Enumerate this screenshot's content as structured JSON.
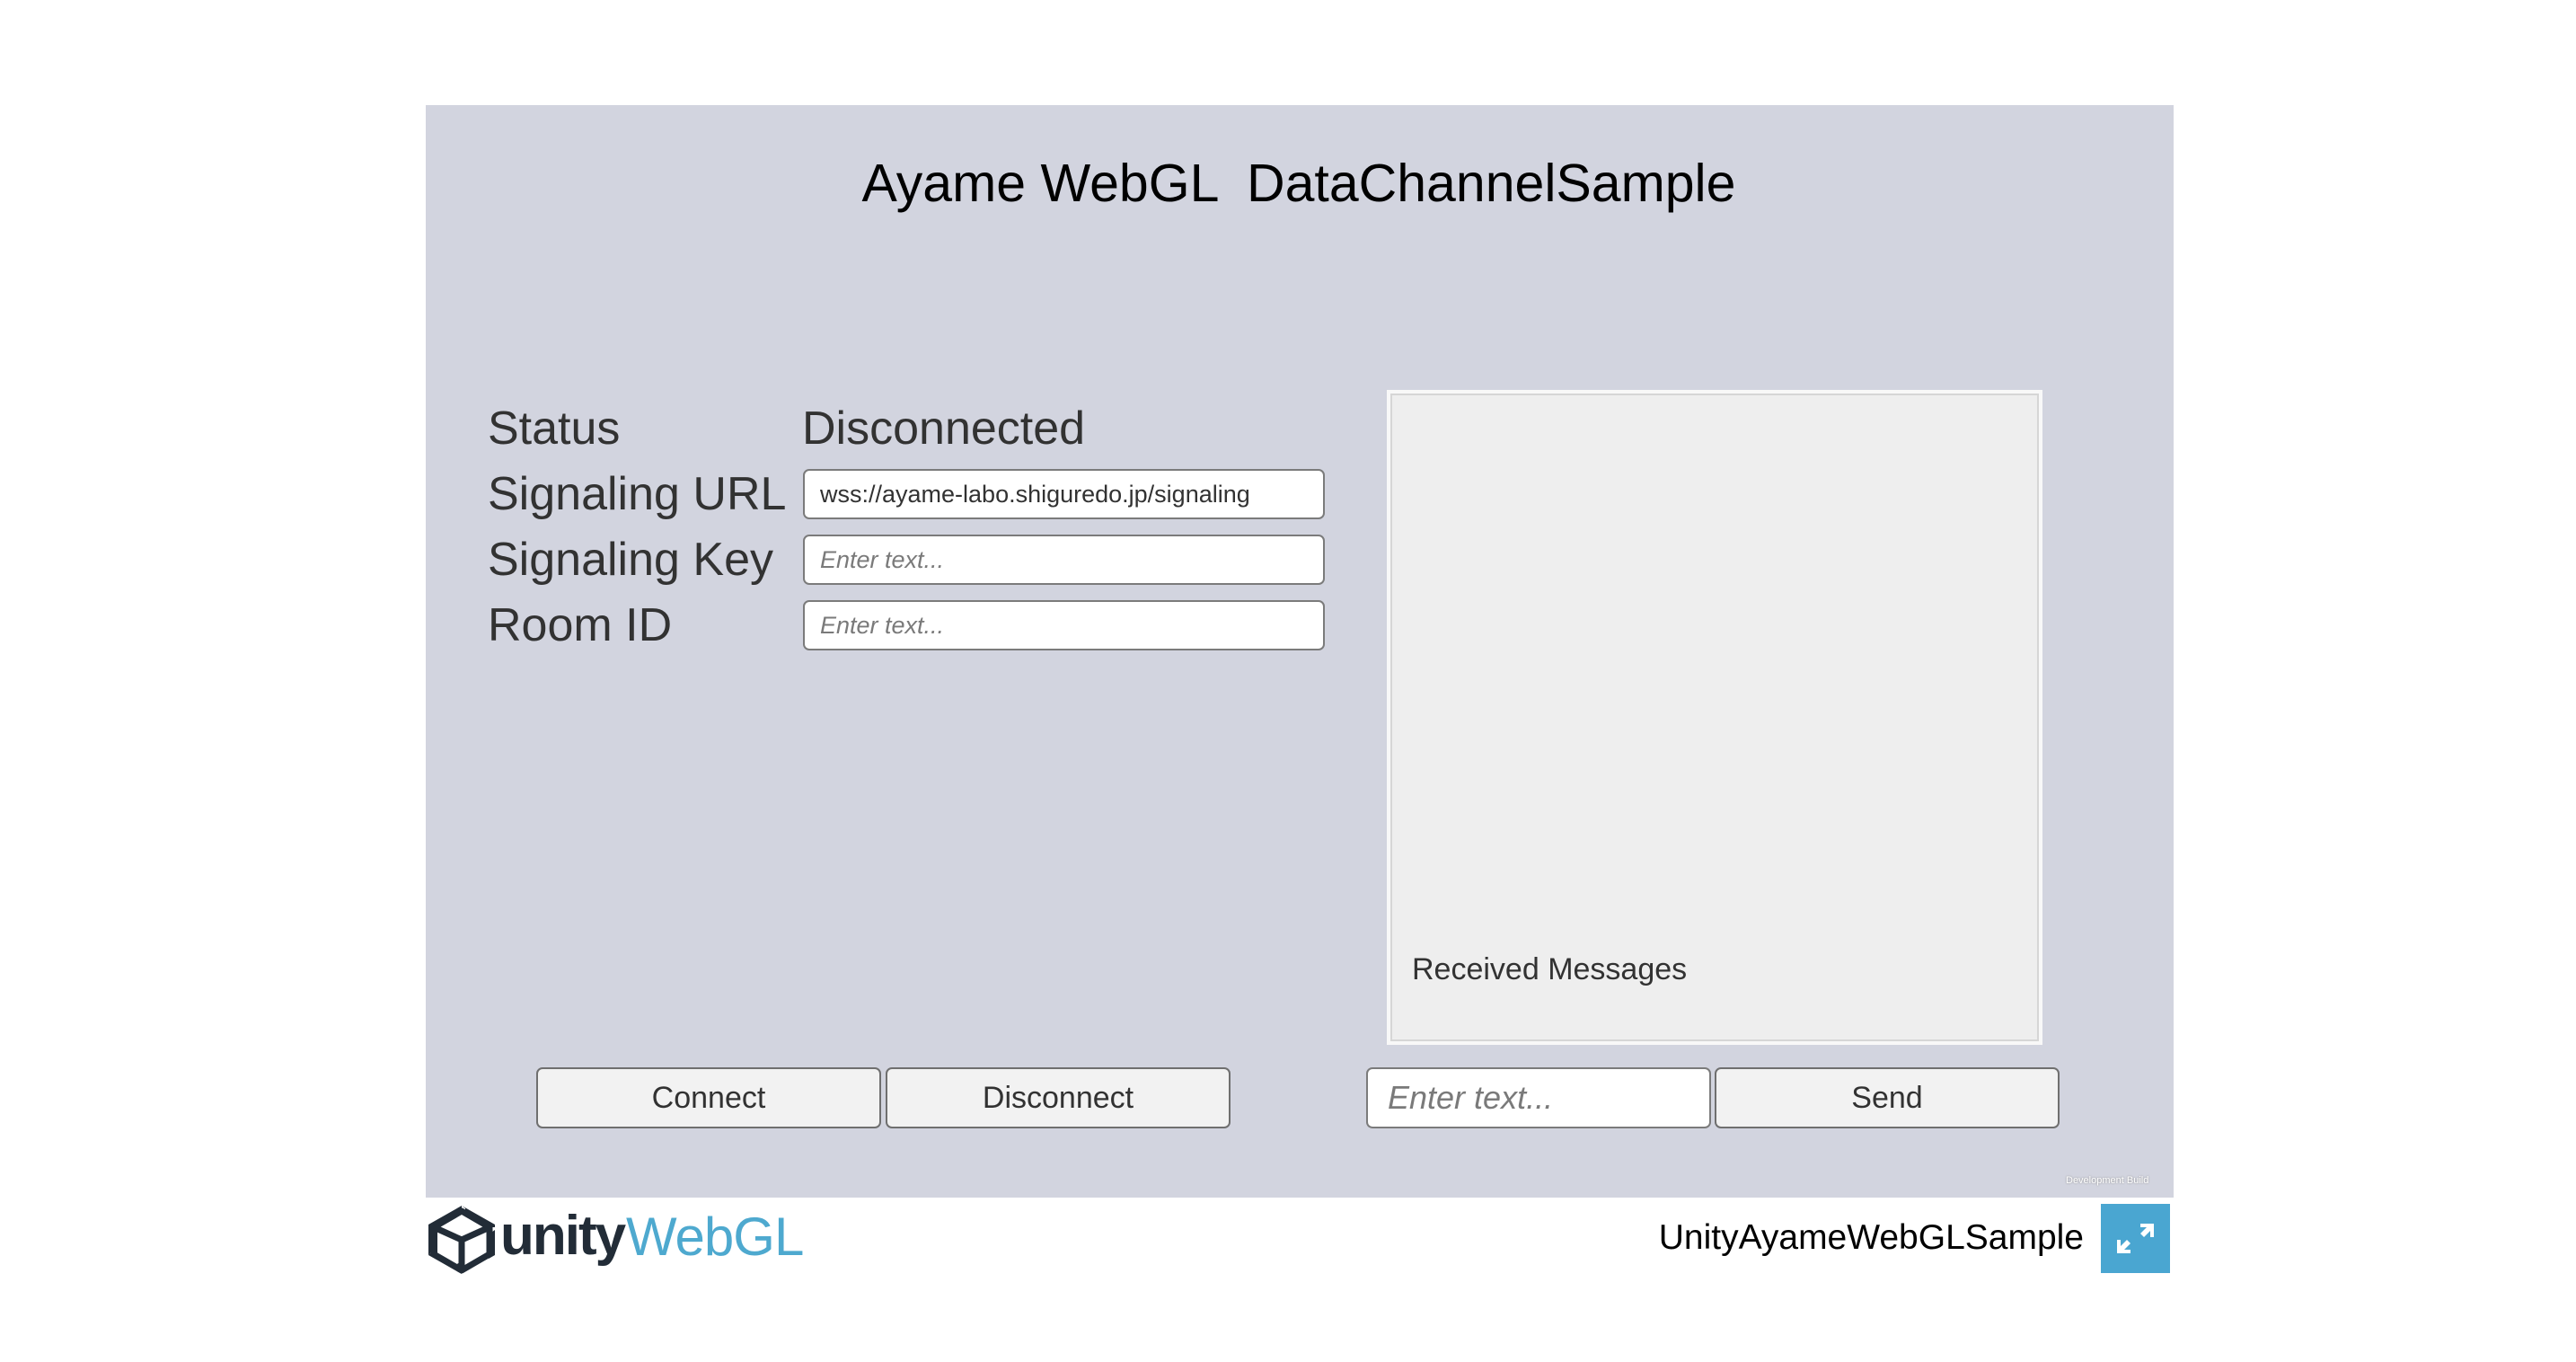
{
  "app": {
    "title": "Ayame WebGL  DataChannelSample"
  },
  "form": {
    "status_label": "Status",
    "status_value": "Disconnected",
    "signaling_url_label": "Signaling URL",
    "signaling_url_value": "wss://ayame-labo.shiguredo.jp/signaling",
    "signaling_key_label": "Signaling Key",
    "signaling_key_placeholder": "Enter text...",
    "room_id_label": "Room ID",
    "room_id_placeholder": "Enter text..."
  },
  "messages": {
    "label": "Received Messages"
  },
  "actions": {
    "connect_label": "Connect",
    "disconnect_label": "Disconnect",
    "message_placeholder": "Enter text...",
    "send_label": "Send"
  },
  "build": {
    "label": "Development Build"
  },
  "footer": {
    "logo_unity": "unity",
    "logo_webgl": "WebGL",
    "product_name": "UnityAyameWebGLSample",
    "fullscreen_icon": "fullscreen-icon"
  },
  "colors": {
    "canvas_background": "#d2d4df",
    "webgl_accent": "#4ea9cf",
    "fullscreen_button": "#4aa6d1"
  }
}
